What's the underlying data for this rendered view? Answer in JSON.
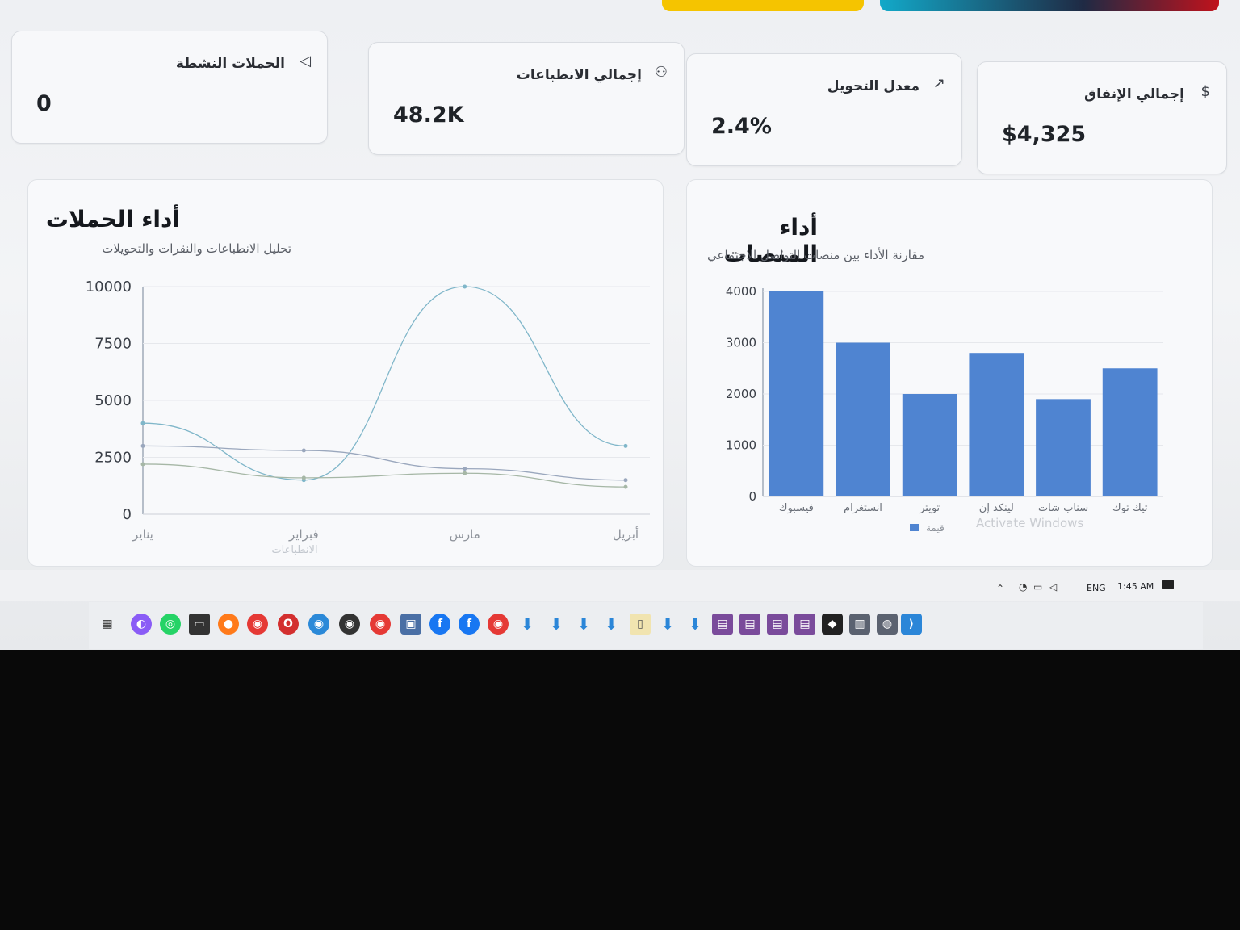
{
  "stats": [
    {
      "title": "الحملات النشطة",
      "value": "0",
      "icon": "megaphone-icon",
      "glyph": "◁"
    },
    {
      "title": "إجمالي الانطباعات",
      "value": "48.2K",
      "icon": "users-icon",
      "glyph": "⚇"
    },
    {
      "title": "معدل التحويل",
      "value": "2.4%",
      "icon": "trending-up-icon",
      "glyph": "↗"
    },
    {
      "title": "إجمالي الإنفاق",
      "value": "$4,325",
      "icon": "dollar-icon",
      "glyph": "$"
    }
  ],
  "campaign_panel": {
    "title": "أداء الحملات",
    "subtitle": "تحليل الانطباعات والنقرات والتحويلات",
    "legend": "الانطباعات"
  },
  "platform_panel": {
    "title": "أداء المنصات",
    "subtitle": "مقارنة الأداء بين منصات التواصل الاجتماعي",
    "legend": "قيمة",
    "watermark": "Activate Windows"
  },
  "chart_data": [
    {
      "type": "line",
      "title": "أداء الحملات",
      "x": [
        "يناير",
        "فبراير",
        "مارس",
        "أبريل"
      ],
      "ylim": [
        0,
        10000
      ],
      "yticks": [
        "10000",
        "7500",
        "5000",
        "2500",
        "0"
      ],
      "series": [
        {
          "name": "الانطباعات",
          "values": [
            4000,
            1500,
            10000,
            3000
          ],
          "color": "#7fb6c9"
        },
        {
          "values": [
            3000,
            2800,
            2000,
            1500
          ],
          "color": "#9aa7bd"
        },
        {
          "values": [
            2200,
            1600,
            1800,
            1200
          ],
          "color": "#a6b7a6"
        }
      ]
    },
    {
      "type": "bar",
      "title": "أداء المنصات",
      "categories": [
        "فيسبوك",
        "انستغرام",
        "تويتر",
        "لينكد إن",
        "سناب شات",
        "تيك توك"
      ],
      "series": [
        {
          "name": "قيمة",
          "values": [
            4000,
            3000,
            2000,
            2800,
            1900,
            2500
          ],
          "color": "#4f84d1"
        }
      ],
      "ylim": [
        0,
        4000
      ],
      "yticks": [
        "4000",
        "3000",
        "2000",
        "1000",
        "0"
      ]
    }
  ],
  "taskbar": {
    "lang": "ENG",
    "time": "1:45 AM",
    "icons": [
      "task-view-icon",
      "copilot-icon",
      "whatsapp-icon",
      "terminal-icon",
      "firefox-icon",
      "chrome-icon",
      "opera-icon",
      "edge-icon",
      "obs-icon",
      "chrome-profile-icon",
      "photos-icon",
      "facebook-icon",
      "facebook-icon-2",
      "chrome-app-icon"
    ],
    "colors": {
      "chrome": "#e53935",
      "firefox": "#ff7a1a",
      "whatsapp": "#25d366",
      "edge": "#2b89d8",
      "opera": "#d32f2f",
      "facebook": "#1877f2",
      "vscode": "#2b86d8",
      "download": "#2b86d8"
    }
  }
}
